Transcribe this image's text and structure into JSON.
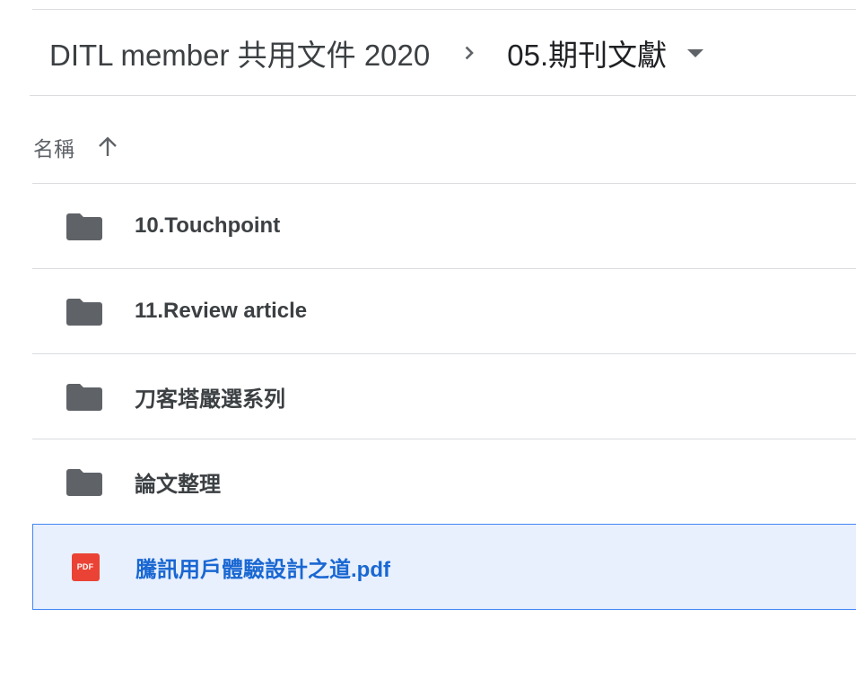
{
  "breadcrumb": {
    "parent": "DITL member 共用文件 2020",
    "current": "05.期刊文獻",
    "separator_icon": "chevron-right-icon",
    "caret_icon": "arrow-drop-down-icon"
  },
  "columns": {
    "name_label": "名稱",
    "sort_icon": "arrow-upward-icon",
    "sort_direction": "ascending"
  },
  "files": [
    {
      "name": "10.Touchpoint",
      "type": "folder",
      "icon": "folder-icon",
      "selected": false
    },
    {
      "name": "11.Review article",
      "type": "folder",
      "icon": "folder-icon",
      "selected": false
    },
    {
      "name": "刀客塔嚴選系列",
      "type": "folder",
      "icon": "folder-icon",
      "selected": false
    },
    {
      "name": "論文整理",
      "type": "folder",
      "icon": "folder-icon",
      "selected": false
    },
    {
      "name": "騰訊用戶體驗設計之道.pdf",
      "type": "pdf",
      "icon": "pdf-icon",
      "icon_text": "PDF",
      "selected": true
    }
  ],
  "colors": {
    "folder": "#5f6368",
    "pdf": "#ea4335",
    "selected_bg": "#e8f0fe",
    "selected_border": "#4285f4",
    "selected_text": "#1967d2",
    "divider": "#dadce0"
  }
}
